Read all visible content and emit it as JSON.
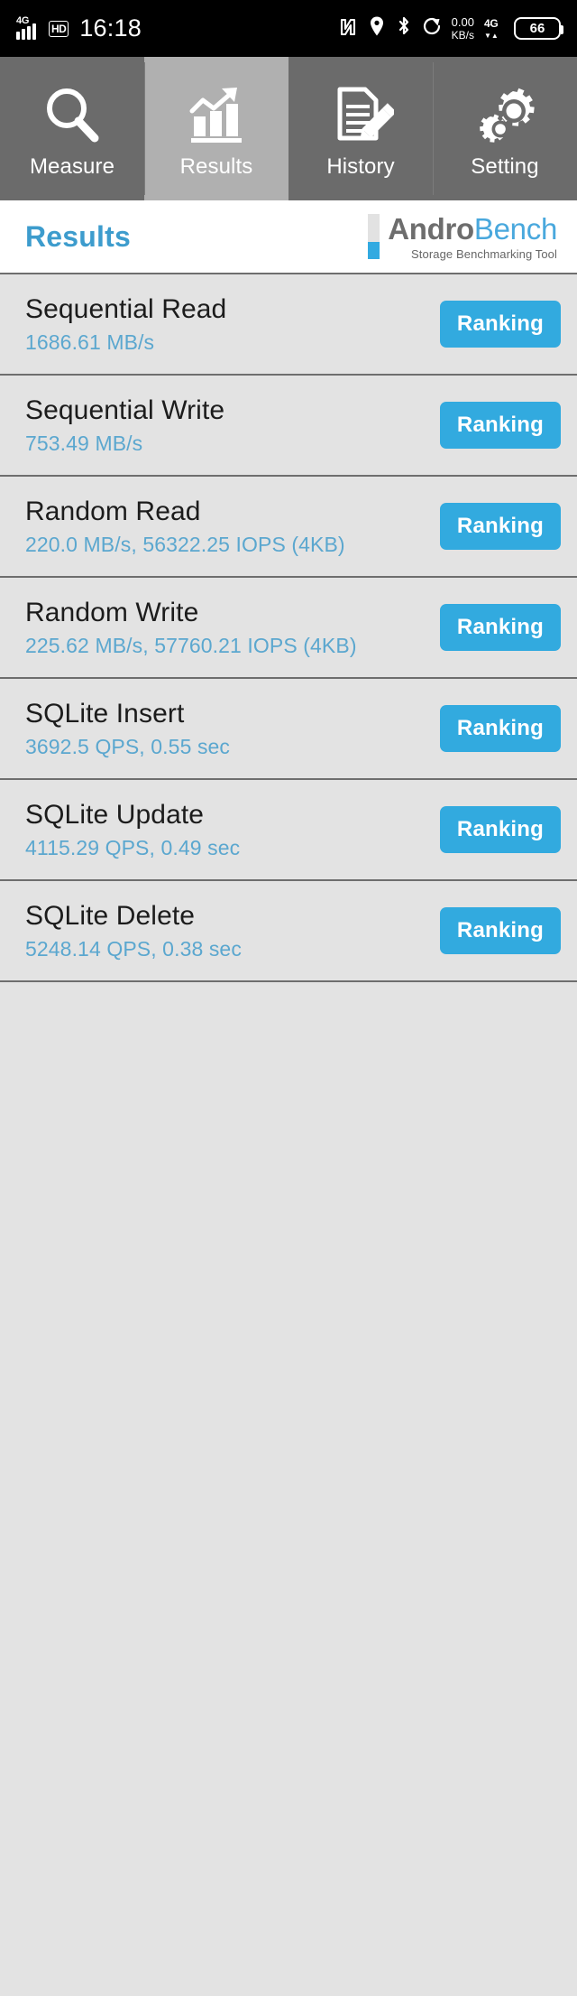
{
  "status_bar": {
    "network_type": "4G",
    "hd_badge": "HD",
    "time": "16:18",
    "nfc_icon": "nfc-icon",
    "location_icon": "location-pin-icon",
    "bluetooth_icon": "bluetooth-icon",
    "rotation_icon": "screen-rotation-icon",
    "net_speed_value": "0.00",
    "net_speed_unit": "KB/s",
    "data_network": "4G",
    "data_arrows": "▼▲",
    "battery_level": "66"
  },
  "tabs": [
    {
      "label": "Measure",
      "icon": "magnifier-icon",
      "active": false
    },
    {
      "label": "Results",
      "icon": "bar-chart-arrow-icon",
      "active": true
    },
    {
      "label": "History",
      "icon": "document-pencil-icon",
      "active": false
    },
    {
      "label": "Setting",
      "icon": "gears-icon",
      "active": false
    }
  ],
  "header": {
    "title": "Results",
    "brand_part1": "Andro",
    "brand_part2": "Bench",
    "brand_tagline": "Storage Benchmarking Tool"
  },
  "results": [
    {
      "title": "Sequential Read",
      "value": "1686.61 MB/s",
      "button": "Ranking"
    },
    {
      "title": "Sequential Write",
      "value": "753.49 MB/s",
      "button": "Ranking"
    },
    {
      "title": "Random Read",
      "value": "220.0 MB/s, 56322.25 IOPS (4KB)",
      "button": "Ranking"
    },
    {
      "title": "Random Write",
      "value": "225.62 MB/s, 57760.21 IOPS (4KB)",
      "button": "Ranking"
    },
    {
      "title": "SQLite Insert",
      "value": "3692.5 QPS, 0.55 sec",
      "button": "Ranking"
    },
    {
      "title": "SQLite Update",
      "value": "4115.29 QPS, 0.49 sec",
      "button": "Ranking"
    },
    {
      "title": "SQLite Delete",
      "value": "5248.14 QPS, 0.38 sec",
      "button": "Ranking"
    }
  ],
  "colors": {
    "accent_blue": "#32aadf",
    "title_blue": "#3d9ccd",
    "value_blue": "#5ba7cf",
    "tab_bg": "#6b6b6b",
    "tab_active_bg": "#b0b0b0",
    "list_bg": "#e3e3e3"
  }
}
